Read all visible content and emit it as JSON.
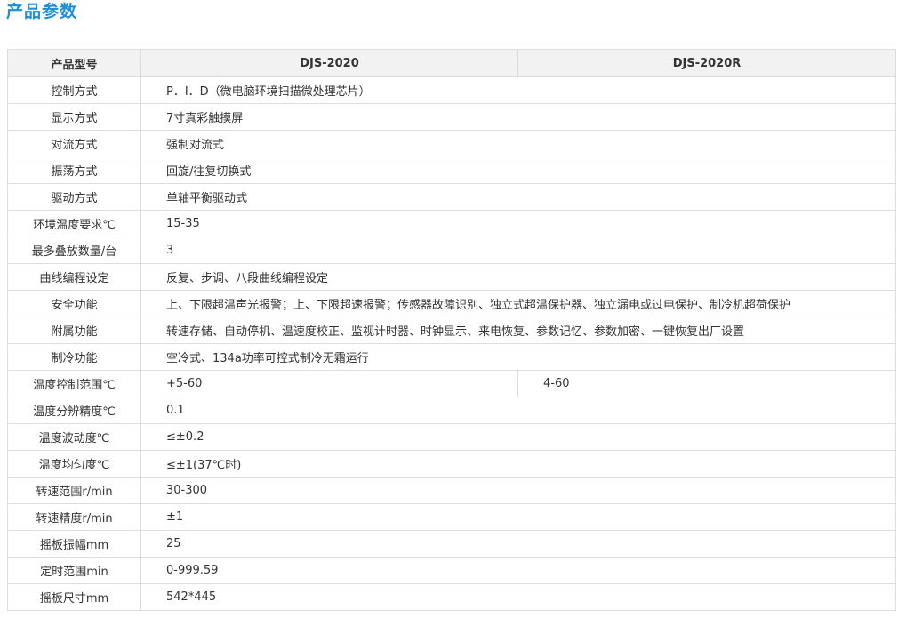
{
  "page": {
    "heading": "产品参数"
  },
  "table": {
    "header": {
      "label": "产品型号",
      "model_a": "DJS-2020",
      "model_b": "DJS-2020R"
    },
    "rows": [
      {
        "label": "控制方式",
        "value": "P．I．D（微电脑环境扫描微处理芯片）"
      },
      {
        "label": "显示方式",
        "value": "7寸真彩触摸屏"
      },
      {
        "label": "对流方式",
        "value": "强制对流式"
      },
      {
        "label": "振荡方式",
        "value": "回旋/往复切换式"
      },
      {
        "label": "驱动方式",
        "value": "单轴平衡驱动式"
      },
      {
        "label": "环境温度要求℃",
        "value": "15-35"
      },
      {
        "label": "最多叠放数量/台",
        "value": "3"
      },
      {
        "label": "曲线编程设定",
        "value": "反复、步调、八段曲线编程设定"
      },
      {
        "label": "安全功能",
        "value": "上、下限超温声光报警；上、下限超速报警；传感器故障识别、独立式超温保护器、独立漏电或过电保护、制冷机超荷保护"
      },
      {
        "label": "附属功能",
        "value": "转速存储、自动停机、温速度校正、监视计时器、时钟显示、来电恢复、参数记忆、参数加密、一键恢复出厂设置"
      },
      {
        "label": "制冷功能",
        "value": "空冷式、134a功率可控式制冷无霜运行"
      },
      {
        "label": "温度控制范围℃",
        "value": "+5-60",
        "value_b": "4-60"
      },
      {
        "label": "温度分辨精度℃",
        "value": "0.1"
      },
      {
        "label": "温度波动度℃",
        "value": "≤±0.2"
      },
      {
        "label": "温度均匀度℃",
        "value": "≤±1(37℃时)"
      },
      {
        "label": "转速范围r/min",
        "value": "30-300"
      },
      {
        "label": "转速精度r/min",
        "value": "±1"
      },
      {
        "label": "摇板振幅mm",
        "value": "25"
      },
      {
        "label": "定时范围min",
        "value": "0-999.59"
      },
      {
        "label": "摇板尺寸mm",
        "value": "542*445"
      }
    ]
  }
}
